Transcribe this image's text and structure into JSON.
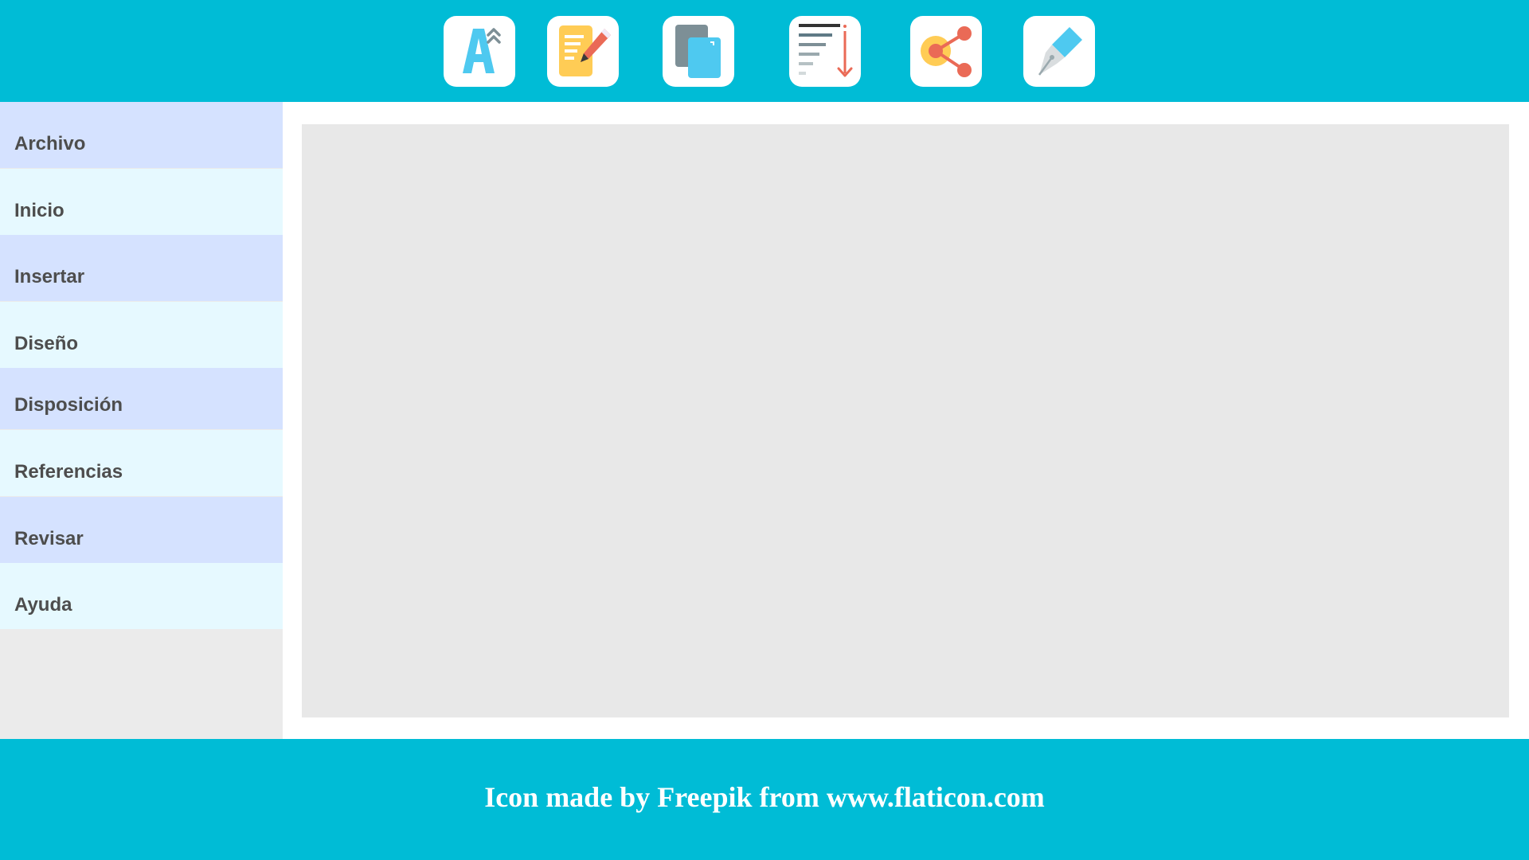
{
  "toolbar": {
    "tools": [
      {
        "icon": "font-size-icon"
      },
      {
        "icon": "edit-document-icon"
      },
      {
        "icon": "copy-pages-icon"
      },
      {
        "icon": "text-sort-icon"
      },
      {
        "icon": "share-icon"
      },
      {
        "icon": "pen-icon"
      }
    ]
  },
  "sidebar": {
    "items": [
      {
        "label": "Archivo"
      },
      {
        "label": "Inicio"
      },
      {
        "label": "Insertar"
      },
      {
        "label": "Diseño"
      },
      {
        "label": "Disposición"
      },
      {
        "label": "Referencias"
      },
      {
        "label": "Revisar"
      },
      {
        "label": "Ayuda"
      }
    ]
  },
  "footer": {
    "credit": "Icon made by Freepik from www.flaticon.com"
  },
  "colors": {
    "header_bg": "#00bcd6",
    "nav_alt_a": "#d5e2ff",
    "nav_alt_b": "#e6f9ff",
    "canvas_bg": "#e8e8e8"
  }
}
